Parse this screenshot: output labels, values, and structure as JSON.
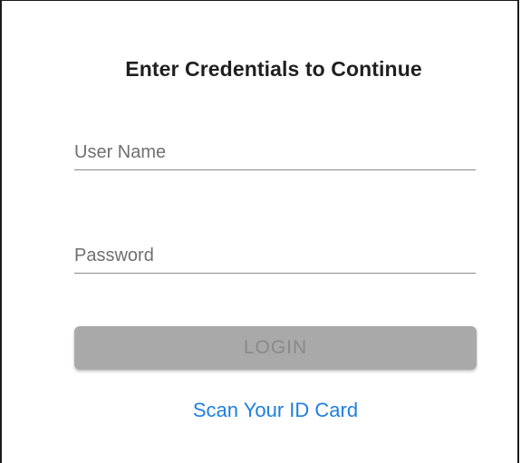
{
  "header": {
    "title": "Enter Credentials to Continue"
  },
  "form": {
    "username": {
      "value": "",
      "placeholder": "User Name"
    },
    "password": {
      "value": "",
      "placeholder": "Password"
    },
    "login_label": "LOGIN",
    "login_enabled": false,
    "scan_link_label": "Scan Your ID Card"
  },
  "colors": {
    "title": "#1f1f1f",
    "login_bg_disabled": "#a9a9a9",
    "login_text_disabled": "#898989",
    "link": "#1f7fe0",
    "underline": "#8a8a8a"
  }
}
